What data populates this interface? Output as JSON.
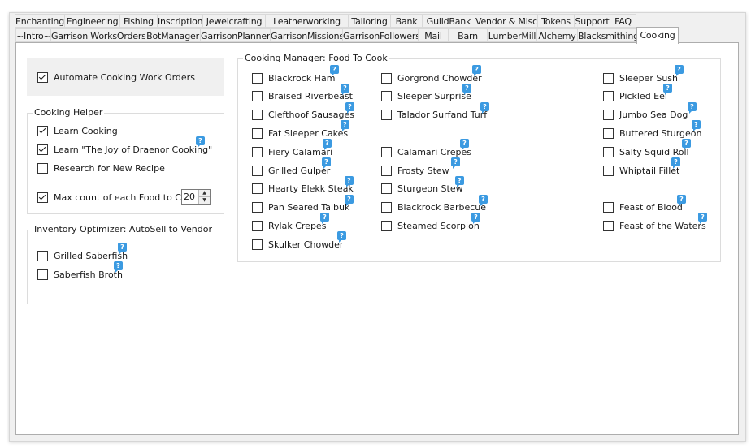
{
  "tabs_row1": [
    "Enchanting",
    "Engineering",
    "Fishing",
    "Inscription",
    "Jewelcrafting",
    "Leatherworking",
    "Tailoring",
    "Bank",
    "GuildBank",
    "Vendor & Misc",
    "Tokens",
    "Support",
    "FAQ"
  ],
  "tabs_row2": [
    "~Intro~",
    "Garrison WorksOrders",
    "BotManager",
    "GarrisonPlanner",
    "GarrisonMissions",
    "GarrisonFollowers",
    "Mail",
    "Barn",
    "LumberMill",
    "Alchemy",
    "Blacksmithing",
    "Cooking"
  ],
  "active_tab": "Cooking",
  "automate": {
    "label": "Automate Cooking Work Orders",
    "checked": true
  },
  "cooking_helper": {
    "title": "Cooking Helper",
    "items": [
      {
        "label": "Learn Cooking",
        "checked": true,
        "help": false
      },
      {
        "label": "Learn \"The Joy of Draenor Cooking\"",
        "checked": true,
        "help": true
      },
      {
        "label": "Research for New Recipe",
        "checked": false,
        "help": false
      },
      {
        "label": "Max count of each Food to Craft",
        "checked": true,
        "help": false
      }
    ],
    "max_count_value": "20"
  },
  "inventory_optimizer": {
    "title": "Inventory Optimizer: AutoSell to Vendor",
    "items": [
      {
        "label": "Grilled Saberfish",
        "checked": false,
        "help": true
      },
      {
        "label": "Saberfish Broth",
        "checked": false,
        "help": true
      }
    ]
  },
  "food_to_cook": {
    "title": "Cooking Manager: Food To Cook",
    "help_glyph": "?",
    "columns": [
      [
        {
          "label": "Blackrock Ham",
          "checked": false
        },
        {
          "label": "Braised Riverbeast",
          "checked": false
        },
        {
          "label": "Clefthoof Sausages",
          "checked": false
        },
        {
          "label": "Fat Sleeper Cakes",
          "checked": false
        },
        {
          "label": "Fiery Calamari",
          "checked": false
        },
        {
          "label": "Grilled Gulper",
          "checked": false
        },
        {
          "label": "Hearty Elekk Steak",
          "checked": false
        },
        {
          "label": "Pan Seared Talbuk",
          "checked": false
        },
        {
          "label": "Rylak Crepes",
          "checked": false
        },
        {
          "label": "Skulker Chowder",
          "checked": false
        }
      ],
      [
        {
          "label": "Gorgrond Chowder",
          "checked": false
        },
        {
          "label": "Sleeper Surprise",
          "checked": false
        },
        {
          "label": "Talador Surfand Turf",
          "checked": false
        },
        null,
        {
          "label": "Calamari Crepes",
          "checked": false
        },
        {
          "label": "Frosty Stew",
          "checked": false
        },
        {
          "label": "Sturgeon Stew",
          "checked": false
        },
        {
          "label": "Blackrock Barbecue",
          "checked": false
        },
        {
          "label": "Steamed Scorpion",
          "checked": false
        },
        null
      ],
      [
        {
          "label": "Sleeper Sushi",
          "checked": false
        },
        {
          "label": "Pickled Eel",
          "checked": false
        },
        {
          "label": "Jumbo Sea Dog",
          "checked": false
        },
        {
          "label": "Buttered Sturgeon",
          "checked": false
        },
        {
          "label": "Salty Squid Roll",
          "checked": false
        },
        {
          "label": "Whiptail Fillet",
          "checked": false
        },
        null,
        {
          "label": "Feast of Blood",
          "checked": false
        },
        {
          "label": "Feast of the Waters",
          "checked": false
        },
        null
      ]
    ]
  }
}
